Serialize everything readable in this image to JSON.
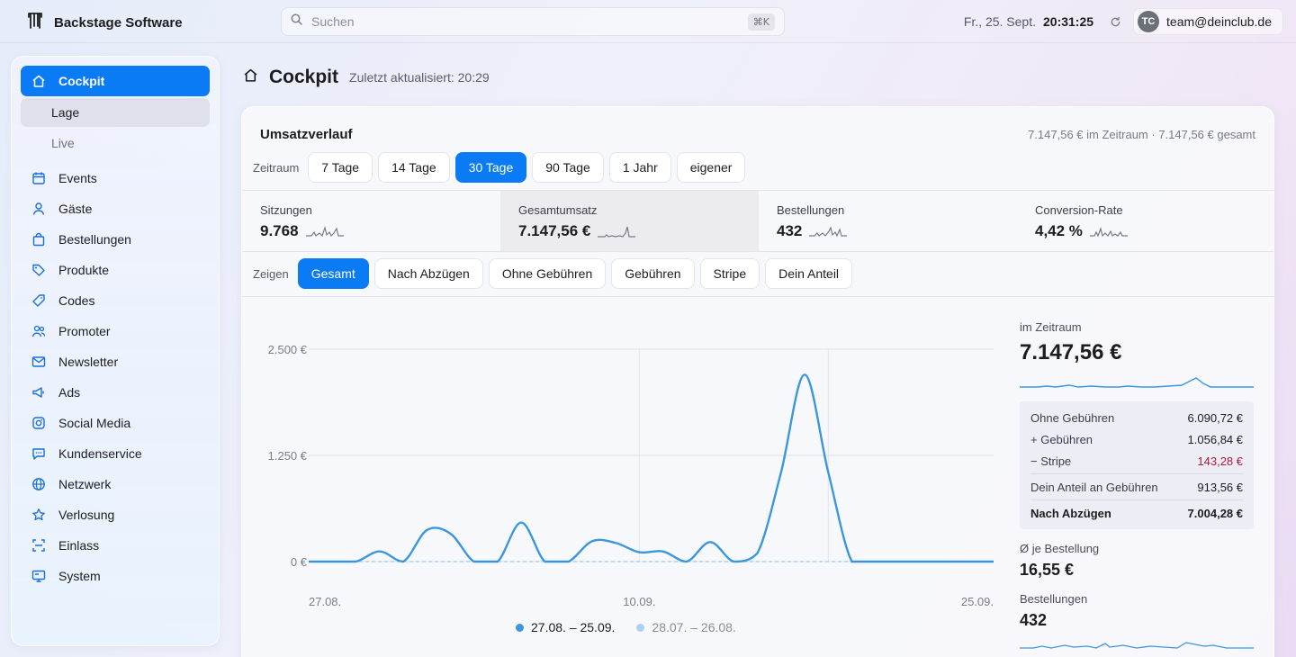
{
  "app": {
    "brand": "Backstage Software"
  },
  "search": {
    "placeholder": "Suchen",
    "shortcut": "⌘K"
  },
  "header": {
    "date": "Fr., 25. Sept.",
    "time": "20:31:25",
    "user_initials": "TC",
    "user_email": "team@deinclub.de"
  },
  "sidebar": {
    "items": [
      {
        "label": "Cockpit",
        "icon": "home-icon",
        "active": true
      },
      {
        "label": "Events",
        "icon": "calendar-icon"
      },
      {
        "label": "Gäste",
        "icon": "person-icon"
      },
      {
        "label": "Bestellungen",
        "icon": "bag-icon"
      },
      {
        "label": "Produkte",
        "icon": "tag-icon"
      },
      {
        "label": "Codes",
        "icon": "ticket-icon"
      },
      {
        "label": "Promoter",
        "icon": "people-icon"
      },
      {
        "label": "Newsletter",
        "icon": "mail-icon"
      },
      {
        "label": "Ads",
        "icon": "megaphone-icon"
      },
      {
        "label": "Social Media",
        "icon": "instagram-icon"
      },
      {
        "label": "Kundenservice",
        "icon": "chat-icon"
      },
      {
        "label": "Netzwerk",
        "icon": "globe-icon"
      },
      {
        "label": "Verlosung",
        "icon": "star-icon"
      },
      {
        "label": "Einlass",
        "icon": "scan-icon"
      },
      {
        "label": "System",
        "icon": "monitor-icon"
      }
    ],
    "subitems": [
      {
        "label": "Lage",
        "current": true
      },
      {
        "label": "Live",
        "current": false
      }
    ]
  },
  "page": {
    "title": "Cockpit",
    "updated": "Zuletzt aktualisiert: 20:29"
  },
  "revenue": {
    "title": "Umsatzverlauf",
    "summary": "7.147,56 € im Zeitraum · 7.147,56 € gesamt",
    "range_label": "Zeitraum",
    "ranges": [
      "7 Tage",
      "14 Tage",
      "30 Tage",
      "90 Tage",
      "1 Jahr",
      "eigener"
    ],
    "range_active": "30 Tage",
    "show_label": "Zeigen",
    "views": [
      "Gesamt",
      "Nach Abzügen",
      "Ohne Gebühren",
      "Gebühren",
      "Stripe",
      "Dein Anteil"
    ],
    "view_active": "Gesamt"
  },
  "kpis": [
    {
      "label": "Sitzungen",
      "value": "9.768"
    },
    {
      "label": "Gesamtumsatz",
      "value": "7.147,56 €",
      "selected": true
    },
    {
      "label": "Bestellungen",
      "value": "432"
    },
    {
      "label": "Conversion-Rate",
      "value": "4,42 %"
    }
  ],
  "panel": {
    "period_label": "im Zeitraum",
    "period_value": "7.147,56 €",
    "breakdown": [
      {
        "label": "Ohne Gebühren",
        "value": "6.090,72 €"
      },
      {
        "label": "+ Gebühren",
        "value": "1.056,84 €"
      },
      {
        "label": "− Stripe",
        "value": "143,28 €"
      },
      {
        "label": "Dein Anteil an Gebühren",
        "value": "913,56 €"
      },
      {
        "label": "Nach Abzügen",
        "value": "7.004,28 €"
      }
    ],
    "avg_label": "Ø je Bestellung",
    "avg_value": "16,55 €",
    "orders_label": "Bestellungen",
    "orders_value": "432"
  },
  "colors": {
    "accent": "#0a7bf5",
    "line": "#3b97dc",
    "prev_line": "#a9d2f2",
    "negative": "#b3183a"
  },
  "chart_data": {
    "type": "line",
    "ylabel": "",
    "ylim": [
      0,
      2500
    ],
    "yticks": [
      "2.500 €",
      "1.250 €",
      "0 €"
    ],
    "yticks_values": [
      2500,
      1250,
      0
    ],
    "xtick_labels": [
      "27.08.",
      "10.09.",
      "25.09."
    ],
    "x": [
      "27.08.",
      "28.08.",
      "29.08.",
      "30.08.",
      "31.08.",
      "01.09.",
      "02.09.",
      "03.09.",
      "04.09.",
      "05.09.",
      "06.09.",
      "07.09.",
      "08.09.",
      "09.09.",
      "10.09.",
      "11.09.",
      "12.09.",
      "13.09.",
      "14.09.",
      "15.09.",
      "16.09.",
      "17.09.",
      "18.09.",
      "19.09.",
      "20.09.",
      "21.09.",
      "22.09.",
      "23.09.",
      "24.09.",
      "25.09."
    ],
    "series": [
      {
        "name": "27.08. – 25.09.",
        "values": [
          0,
          0,
          0,
          120,
          0,
          370,
          330,
          0,
          0,
          460,
          0,
          0,
          240,
          220,
          110,
          120,
          0,
          230,
          0,
          100,
          1050,
          2200,
          1050,
          0,
          0,
          0,
          0,
          0,
          0,
          0
        ]
      },
      {
        "name": "28.07. – 26.08.",
        "values": [
          0,
          0,
          0,
          0,
          0,
          0,
          0,
          0,
          0,
          0,
          0,
          0,
          0,
          0,
          0,
          0,
          0,
          0,
          0,
          0,
          0,
          0,
          0,
          0,
          0,
          0,
          0,
          0,
          0,
          0
        ]
      }
    ]
  }
}
